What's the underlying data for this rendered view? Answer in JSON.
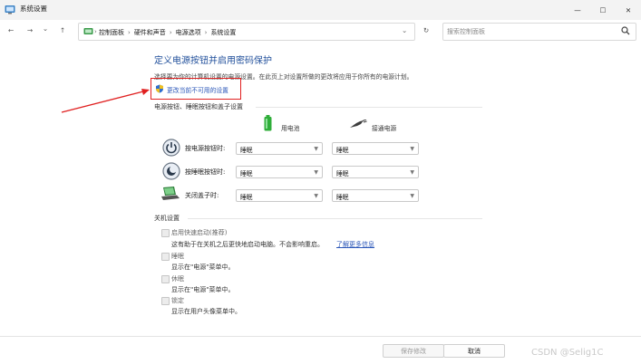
{
  "window": {
    "title": "系统设置"
  },
  "controls": {
    "minimize": "—",
    "maximize": "☐",
    "close": "✕"
  },
  "nav": {
    "back": "←",
    "forward": "→",
    "dropdown": "⌄",
    "up": "↑",
    "breadcrumbs": [
      "控制面板",
      "硬件和声音",
      "电源选项",
      "系统设置"
    ],
    "address_dropdown": "⌄",
    "refresh": "↻",
    "search_placeholder": "搜索控制面板"
  },
  "page": {
    "heading": "定义电源按钮并启用密码保护",
    "description": "选择要为你的计算机设置的电源设置。在此页上对设置所做的更改将应用于你所有的电源计划。",
    "change_link": "更改当前不可用的设置",
    "power_section": "电源按钮、睡眠按钮和盖子设置",
    "col_battery": "用电池",
    "col_plugged": "接通电源",
    "rows": [
      {
        "label": "按电源按钮时:",
        "battery": "睡眠",
        "plugged": "睡眠"
      },
      {
        "label": "按睡眠按钮时:",
        "battery": "睡眠",
        "plugged": "睡眠"
      },
      {
        "label": "关闭盖子时:",
        "battery": "睡眠",
        "plugged": "睡眠"
      }
    ],
    "shutdown_section": "关机设置",
    "options": [
      {
        "label": "启用快速启动(推荐)",
        "desc": "这有助于在关机之后更快地启动电脑。不会影响重启。",
        "link": "了解更多信息"
      },
      {
        "label": "睡眠",
        "desc": "显示在\"电源\"菜单中。"
      },
      {
        "label": "休眠",
        "desc": "显示在\"电源\"菜单中。"
      },
      {
        "label": "锁定",
        "desc": "显示在用户头像菜单中。"
      }
    ]
  },
  "footer": {
    "save": "保存修改",
    "cancel": "取消"
  },
  "watermark": "CSDN @Selig1C",
  "colors": {
    "heading": "#1f4e9a",
    "link": "#2a56b8",
    "annotation": "#e02020",
    "battery": "#2fae3a"
  },
  "annotation": {
    "type": "red-arrow-and-box",
    "target": "change-settings-link"
  }
}
